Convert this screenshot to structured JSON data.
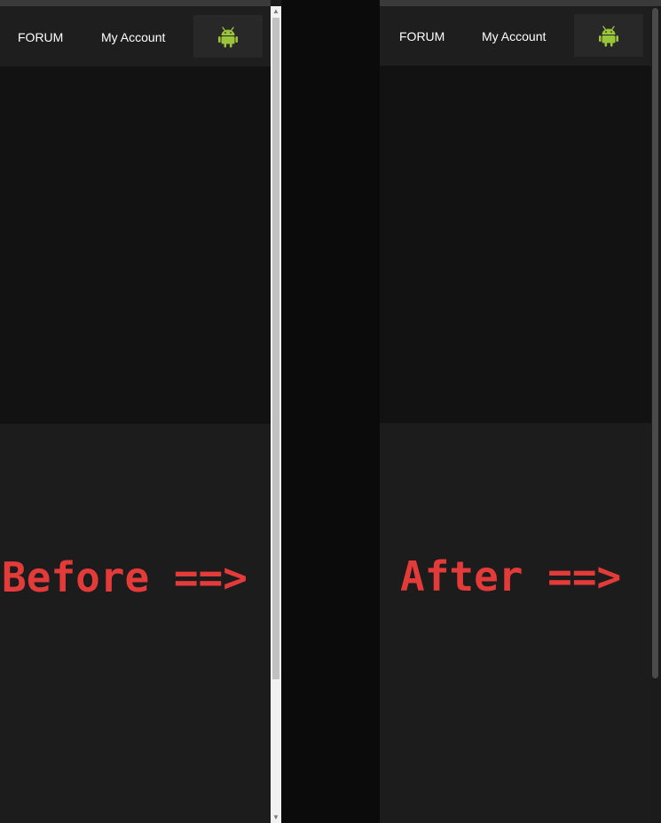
{
  "before": {
    "nav": {
      "forum_label": "FORUM",
      "account_label": "My Account",
      "app_button_icon": "android-icon"
    },
    "caption": "Before ==>",
    "scrollbar_style": "light"
  },
  "after": {
    "nav": {
      "forum_label": "FORUM",
      "account_label": "My Account",
      "app_button_icon": "android-icon"
    },
    "caption": "After ==>",
    "scrollbar_style": "dark"
  },
  "colors": {
    "caption": "#e33a3a",
    "android": "#9ac43a",
    "navbar_bg": "#1e1e1e",
    "hero_bg": "#121212",
    "content_bg": "#1c1c1c"
  }
}
